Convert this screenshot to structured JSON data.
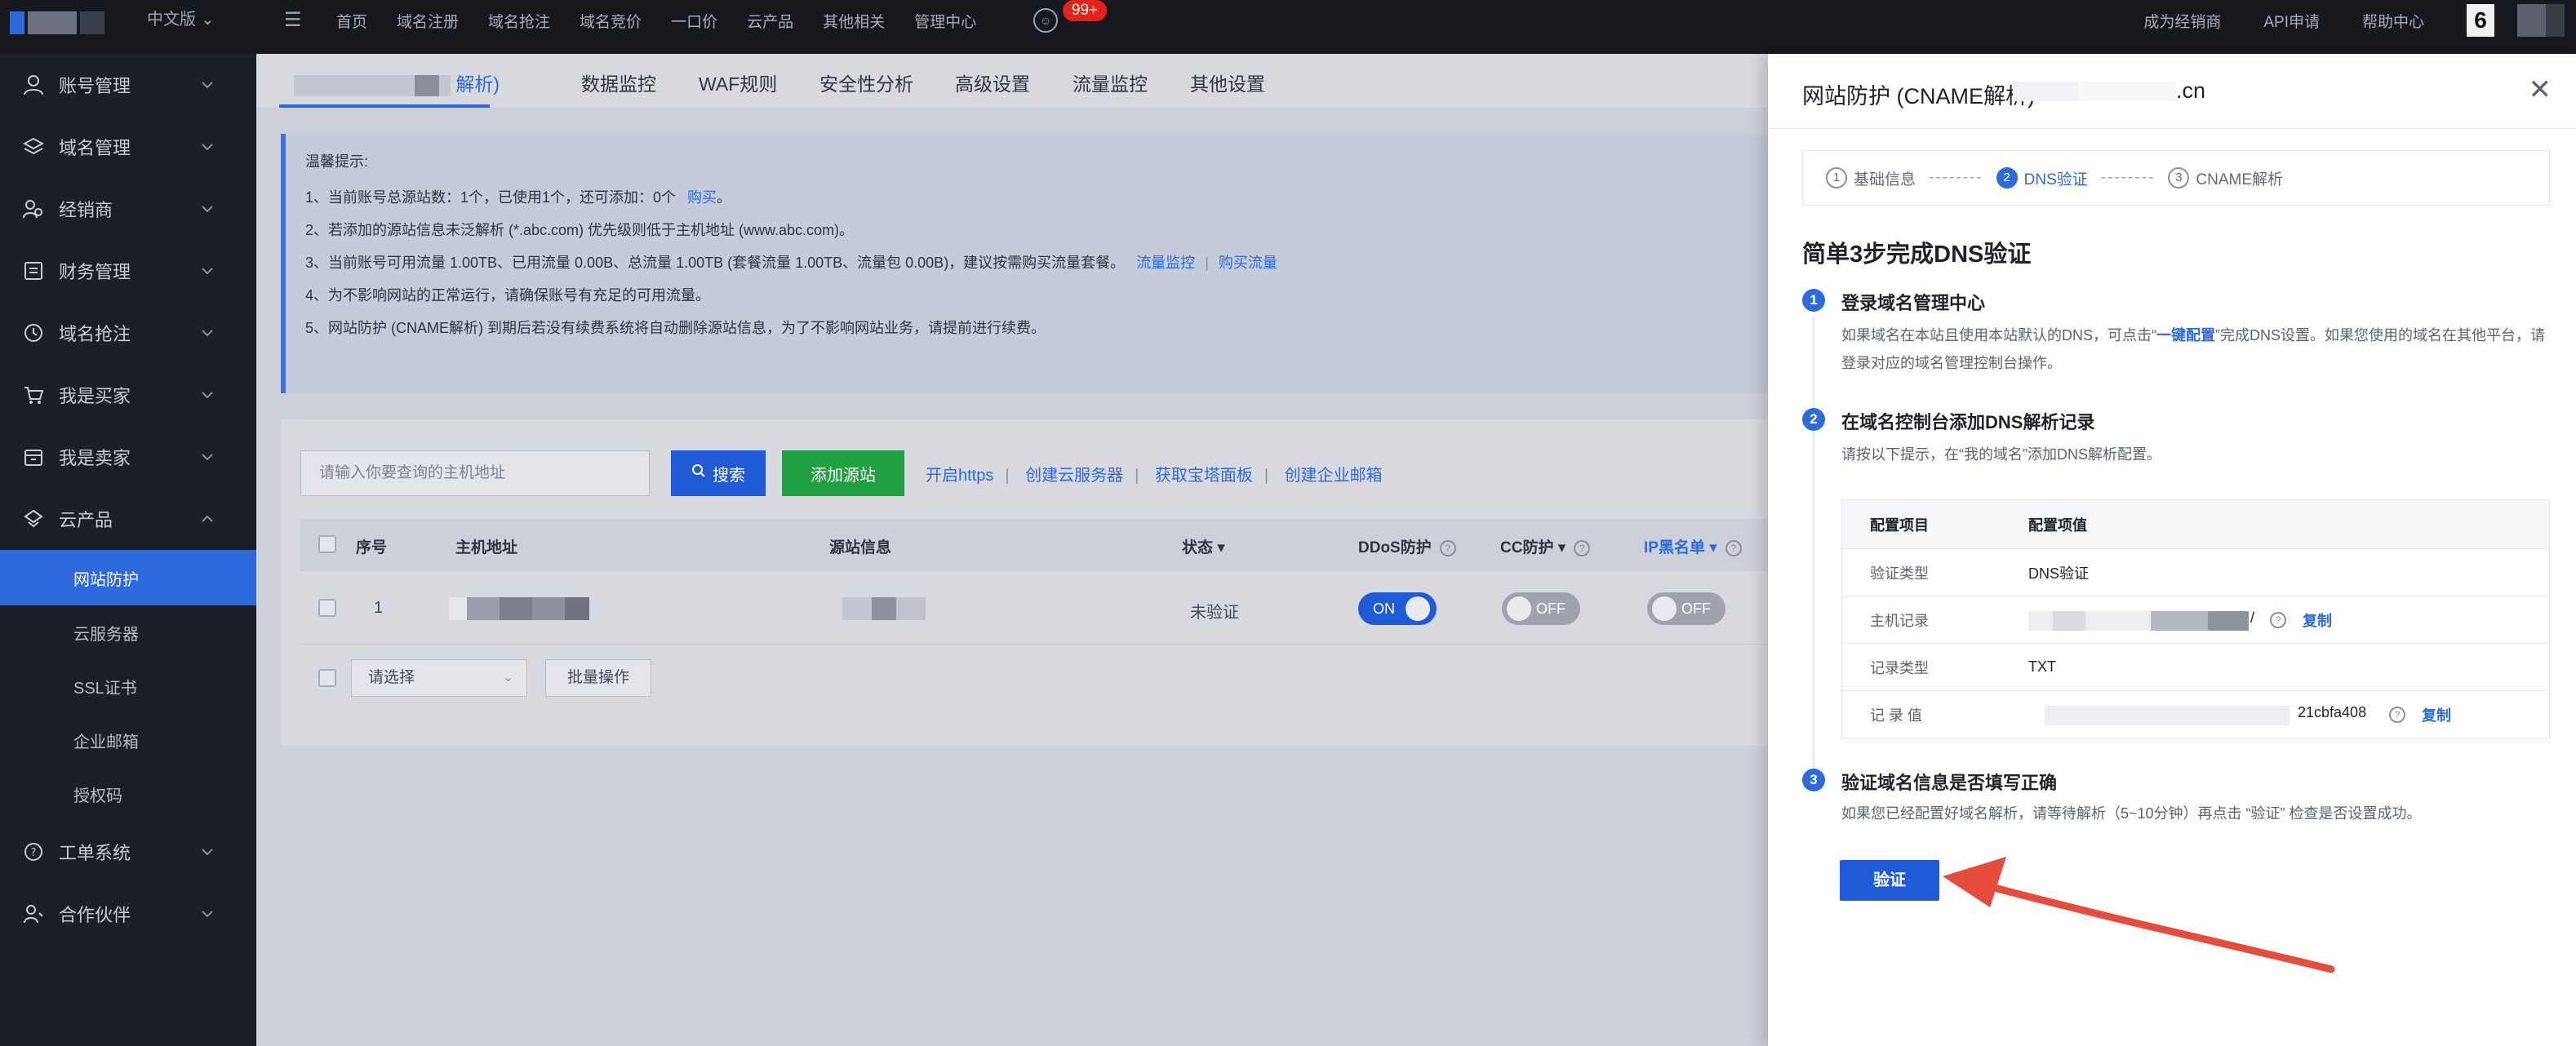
{
  "topbar": {
    "lang": "中文版",
    "nav": [
      "首页",
      "域名注册",
      "域名抢注",
      "域名竞价",
      "一口价",
      "云产品",
      "其他相关",
      "管理中心"
    ],
    "badge": "99+",
    "right_links": [
      "成为经销商",
      "API申请",
      "帮助中心"
    ],
    "notif_count": "6"
  },
  "sidebar": {
    "items": [
      {
        "label": "账号管理",
        "icon": "user-icon"
      },
      {
        "label": "域名管理",
        "icon": "layers-icon"
      },
      {
        "label": "经销商",
        "icon": "users-icon"
      },
      {
        "label": "财务管理",
        "icon": "ledger-icon"
      },
      {
        "label": "域名抢注",
        "icon": "clock-icon"
      },
      {
        "label": "我是买家",
        "icon": "cart-icon"
      },
      {
        "label": "我是卖家",
        "icon": "store-icon"
      },
      {
        "label": "云产品",
        "icon": "cloud-icon"
      }
    ],
    "sub_items": [
      "网站防护",
      "云服务器",
      "SSL证书",
      "企业邮箱",
      "授权码"
    ],
    "bottom_items": [
      {
        "label": "工单系统",
        "icon": "question-icon"
      },
      {
        "label": "合作伙伴",
        "icon": "partner-icon"
      }
    ]
  },
  "tabs": {
    "first_suffix": "解析)",
    "items": [
      "数据监控",
      "WAF规则",
      "安全性分析",
      "高级设置",
      "流量监控",
      "其他设置"
    ]
  },
  "tips": {
    "title": "温馨提示:",
    "lines": [
      "1、当前账号总源站数：1个，已使用1个，还可添加：0个",
      "2、若添加的源站信息未泛解析 (*.abc.com) 优先级则低于主机地址 (www.abc.com)。",
      "3、当前账号可用流量 1.00TB、已用流量 0.00B、总流量 1.00TB (套餐流量 1.00TB、流量包 0.00B)，建议按需购买流量套餐。",
      "4、为不影响网站的正常运行，请确保账号有充足的可用流量。",
      "5、网站防护 (CNAME解析) 到期后若没有续费系统将自动删除源站信息，为了不影响网站业务，请提前进行续费。"
    ],
    "buy_link": "购买",
    "traffic_monitor_link": "流量监控",
    "buy_traffic_link": "购买流量"
  },
  "toolbar": {
    "search_placeholder": "请输入你要查询的主机地址",
    "search_button": "搜索",
    "add_button": "添加源站",
    "links": [
      "开启https",
      "创建云服务器",
      "获取宝塔面板",
      "创建企业邮箱"
    ]
  },
  "table": {
    "headers": [
      "序号",
      "主机地址",
      "源站信息",
      "状态",
      "DDoS防护",
      "CC防护",
      "IP黑名单"
    ],
    "rows": [
      {
        "index": "1",
        "status": "未验证",
        "ddos": "ON",
        "cc": "OFF",
        "ip": "OFF"
      }
    ],
    "batch_select_placeholder": "请选择",
    "batch_button": "批量操作"
  },
  "drawer": {
    "title": "网站防护 (CNAME解析)",
    "domain": ".cn",
    "steps": [
      "基础信息",
      "DNS验证",
      "CNAME解析"
    ],
    "step_numbers": [
      "1",
      "2",
      "3"
    ],
    "step_dashes": "--------",
    "heading": "简单3步完成DNS验证",
    "sections": [
      {
        "num": "1",
        "title": "登录域名管理中心",
        "desc_before": "如果域名在本站且使用本站默认的DNS，可点击“",
        "desc_highlight": "一键配置",
        "desc_after": "”完成DNS设置。如果您使用的域名在其他平台，请登录对应的域名管理控制台操作。"
      },
      {
        "num": "2",
        "title": "在域名控制台添加DNS解析记录",
        "desc": "请按以下提示，在“我的域名”添加DNS解析配置。"
      },
      {
        "num": "3",
        "title": "验证域名信息是否填写正确",
        "desc": "如果您已经配置好域名解析，请等待解析（5~10分钟）再点击 “验证” 检查是否设置成功。"
      }
    ],
    "config_table": {
      "headers": [
        "配置项目",
        "配置项值"
      ],
      "rows": [
        {
          "label": "验证类型",
          "value": "DNS验证"
        },
        {
          "label": "主机记录",
          "value": "/",
          "copy": "复制"
        },
        {
          "label": "记录类型",
          "value": "TXT"
        },
        {
          "label": "记 录 值",
          "value": "21cbfa408",
          "copy": "复制"
        }
      ]
    },
    "verify_button": "验证"
  },
  "colors": {
    "primary": "#2d6bdc",
    "add_green": "#21a143",
    "badge_red": "#e2231a",
    "arrow_red": "#e54c3c"
  }
}
